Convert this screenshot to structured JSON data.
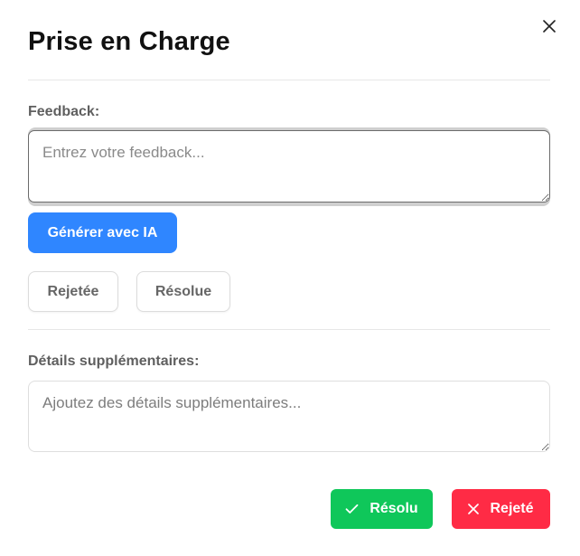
{
  "modal": {
    "title": "Prise en Charge",
    "close_icon": "close-icon"
  },
  "feedback": {
    "label": "Feedback:",
    "placeholder": "Entrez votre feedback...",
    "value": ""
  },
  "ai_button": {
    "label": "Générer avec IA",
    "color": "#2f86ff"
  },
  "status_options": [
    {
      "label": "Rejetée"
    },
    {
      "label": "Résolue"
    }
  ],
  "details": {
    "label": "Détails supplémentaires:",
    "placeholder": "Ajoutez des détails supplémentaires...",
    "value": ""
  },
  "actions": {
    "resolved": {
      "label": "Résolu",
      "icon": "check-icon",
      "color": "#0fc75a"
    },
    "rejected": {
      "label": "Rejeté",
      "icon": "x-icon",
      "color": "#ff2b45"
    }
  }
}
